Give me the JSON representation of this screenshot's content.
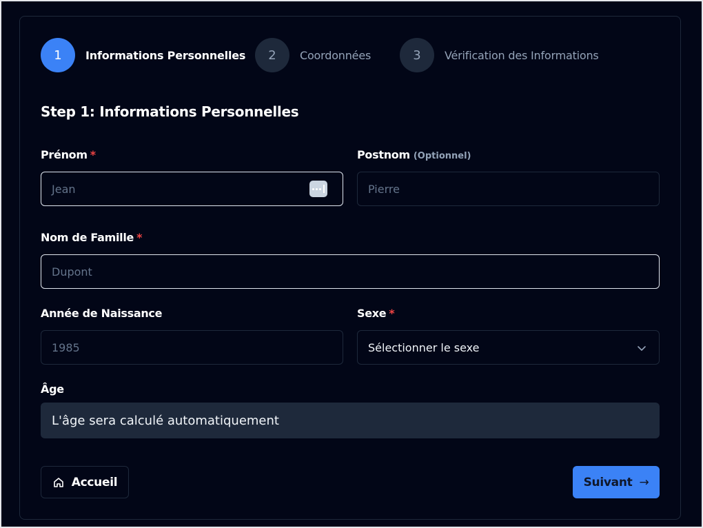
{
  "stepper": {
    "steps": [
      {
        "number": "1",
        "label": "Informations Personnelles",
        "state": "active"
      },
      {
        "number": "2",
        "label": "Coordonnées",
        "state": "inactive"
      },
      {
        "number": "3",
        "label": "Vérification des Informations",
        "state": "inactive"
      }
    ]
  },
  "form": {
    "section_title": "Step 1: Informations Personnelles",
    "required_mark": "*",
    "prenom": {
      "label": "Prénom",
      "placeholder": "Jean"
    },
    "postnom": {
      "label": "Postnom",
      "optional": "(Optionnel)",
      "placeholder": "Pierre"
    },
    "nom_famille": {
      "label": "Nom de Famille",
      "placeholder": "Dupont"
    },
    "annee": {
      "label": "Année de Naissance",
      "placeholder": "1985"
    },
    "sexe": {
      "label": "Sexe",
      "selected": "Sélectionner le sexe"
    },
    "age": {
      "label": "Âge",
      "value": "L'âge sera calculé automatiquement"
    }
  },
  "actions": {
    "home_label": "Accueil",
    "next_label": "Suivant",
    "next_arrow": "→"
  },
  "colors": {
    "accent": "#3b82f6",
    "background": "#020617",
    "required": "#ef4444"
  }
}
